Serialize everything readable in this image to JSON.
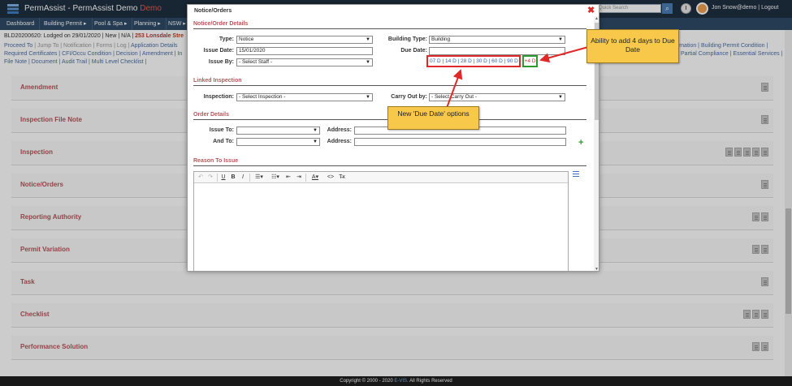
{
  "app": {
    "title_main": "PermAssist - PermAssist Demo",
    "title_demo": "Demo",
    "search_placeholder": "Quick Search",
    "user_text": "Jon Snow@demo | Logout",
    "search_icon": "search-icon",
    "clock_icon": "clock-icon"
  },
  "nav": {
    "items": [
      "Dashboard",
      "Building Permit ▸",
      "Pool & Spa ▸",
      "Planning ▸",
      "NSW ▸"
    ]
  },
  "case": {
    "prefix": "BLD20200620: Lodged on 29/01/2020 | New | N/A |",
    "address": "253 Lonsdale Stre"
  },
  "actions": {
    "line1_active": "Proceed To",
    "line1_rest": "| Jump To | Notification | Forms | Log |",
    "line1_link": "Application Details",
    "line2": "Required Certificates | CFI/Occu Condition | Decision | Amendment | In",
    "line3": "File Note | Document | Audit Trail | Multi Level Checklist |",
    "right1": "ormation | Building Permit Condition |",
    "right2": "Partial Compliance | Essential Services |"
  },
  "sections": [
    {
      "title": "Amendment"
    },
    {
      "title": "Inspection File Note"
    },
    {
      "title": "Inspection"
    },
    {
      "title": "Notice/Orders"
    },
    {
      "title": "Reporting Authority"
    },
    {
      "title": "Permit Variation"
    },
    {
      "title": "Task"
    },
    {
      "title": "Checklist"
    },
    {
      "title": "Performance Solution"
    }
  ],
  "modal": {
    "title": "Notice/Orders",
    "close": "✖",
    "section_details": "Notice/Order Details",
    "section_inspection": "Linked Inspection",
    "section_order": "Order Details",
    "section_reason": "Reason To Issue",
    "type_label": "Type:",
    "type_value": "Notice",
    "issue_date_label": "Issue Date:",
    "issue_date_value": "15/01/2020",
    "issue_by_label": "Issue By:",
    "issue_by_value": "- Select Staff -",
    "building_type_label": "Building Type:",
    "building_type_value": "Building",
    "due_date_label": "Due Date:",
    "due_date_value": "",
    "due_options": "07 D | 14 D | 28 D | 30 D | 60 D | 90 D",
    "due_plus": "+4 D",
    "inspection_label": "Inspection:",
    "inspection_value": "- Select Inspection -",
    "carry_out_label": "Carry Out by:",
    "carry_out_value": "- Select Carry Out -",
    "issue_to_label": "Issue To:",
    "and_to_label": "And To:",
    "address_label": "Address:",
    "add_icon": "plus-icon"
  },
  "editor": {
    "buttons": [
      "↶",
      "↷",
      "U",
      "B",
      "I",
      "☰▾",
      "☷▾",
      "⇤",
      "⇥",
      "A▾",
      "<>",
      "T̶x"
    ]
  },
  "callouts": {
    "due_date_options": "New 'Due Date' options",
    "add_days": "Ability to add 4 days to Due Date"
  },
  "footer": {
    "prefix": "Copyright © 2000 - 2020",
    "brand": "E-VIS.",
    "suffix": "All Rights Reserved"
  }
}
